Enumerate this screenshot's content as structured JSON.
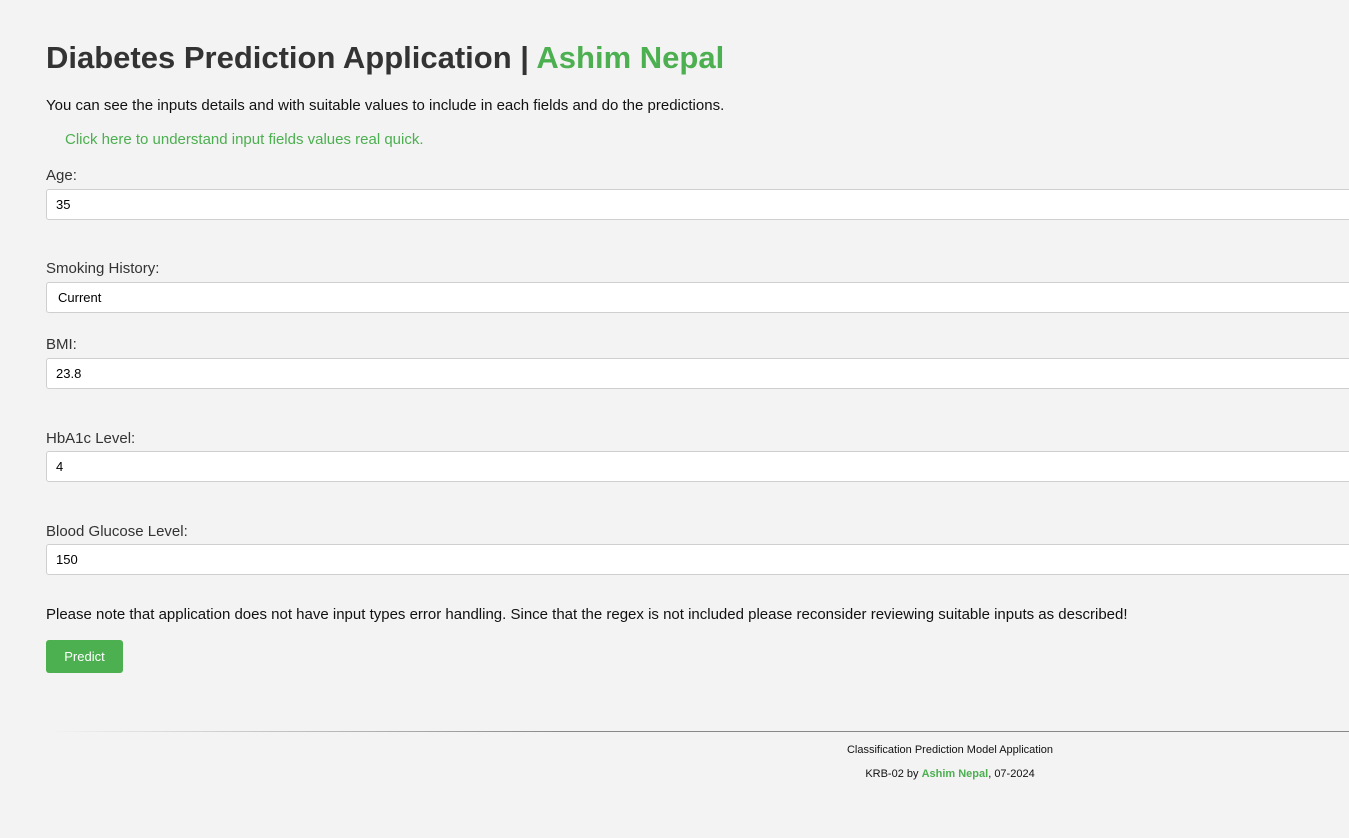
{
  "header": {
    "title_main": "Diabetes Prediction Application | ",
    "title_accent": "Ashim Nepal"
  },
  "intro_text": "You can see the inputs details and with suitable values to include in each fields and do the predictions.",
  "help_link": "Click here to understand input fields values real quick.",
  "form": {
    "age": {
      "label": "Age:",
      "value": "35"
    },
    "smoking_history": {
      "label": "Smoking History:",
      "selected": "Current"
    },
    "bmi": {
      "label": "BMI:",
      "value": "23.8"
    },
    "hba1c": {
      "label": "HbA1c Level:",
      "value": "4"
    },
    "blood_glucose": {
      "label": "Blood Glucose Level:",
      "value": "150"
    }
  },
  "note_text": "Please note that application does not have input types error handling. Since that the regex is not included please reconsider reviewing suitable inputs as described!",
  "predict_button": "Predict",
  "footer": {
    "line1": "Classification Prediction Model Application",
    "prefix": "KRB-02 by ",
    "author": "Ashim Nepal",
    "suffix": ", 07-2024"
  },
  "colors": {
    "accent": "#4caf50",
    "background": "#f3f3f3"
  }
}
